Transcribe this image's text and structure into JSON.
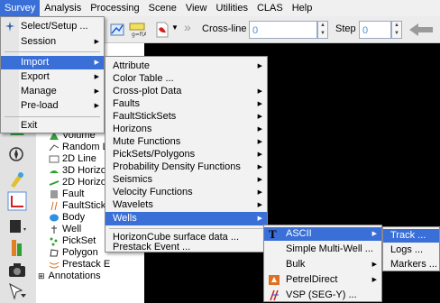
{
  "menubar": [
    "Survey",
    "Analysis",
    "Processing",
    "Scene",
    "View",
    "Utilities",
    "CLAS",
    "Help"
  ],
  "toolbar": {
    "crossline_label": "Cross-line",
    "crossline_value": "0",
    "step_label": "Step",
    "step_value": "0"
  },
  "survey_menu": {
    "items": [
      "Select/Setup ...",
      "Session",
      "Import",
      "Export",
      "Manage",
      "Pre-load",
      "Exit"
    ]
  },
  "import_menu": {
    "items": [
      "Attribute",
      "Color Table ...",
      "Cross-plot Data",
      "Faults",
      "FaultStickSets",
      "Horizons",
      "Mute Functions",
      "PickSets/Polygons",
      "Probability Density Functions",
      "Seismics",
      "Velocity Functions",
      "Wavelets",
      "Wells",
      "HorizonCube surface data ...",
      "Prestack Event ..."
    ]
  },
  "wells_menu": {
    "items": [
      "ASCII",
      "Simple Multi-Well ...",
      "Bulk",
      "PetrelDirect",
      "VSP (SEG-Y) ..."
    ]
  },
  "ascii_menu": {
    "items": [
      "Track ...",
      "Logs ...",
      "Markers ..."
    ]
  },
  "tree": {
    "items": [
      "Volume",
      "Random L",
      "2D Line",
      "3D Horizo",
      "2D Horizo",
      "Fault",
      "FaultStick",
      "Body",
      "Well",
      "PickSet",
      "Polygon",
      "Prestack E",
      "Annotations"
    ]
  },
  "colors": {
    "highlight": "#3a6fd8",
    "viewport": "#000000",
    "spin_value": "#5a8fd6"
  }
}
